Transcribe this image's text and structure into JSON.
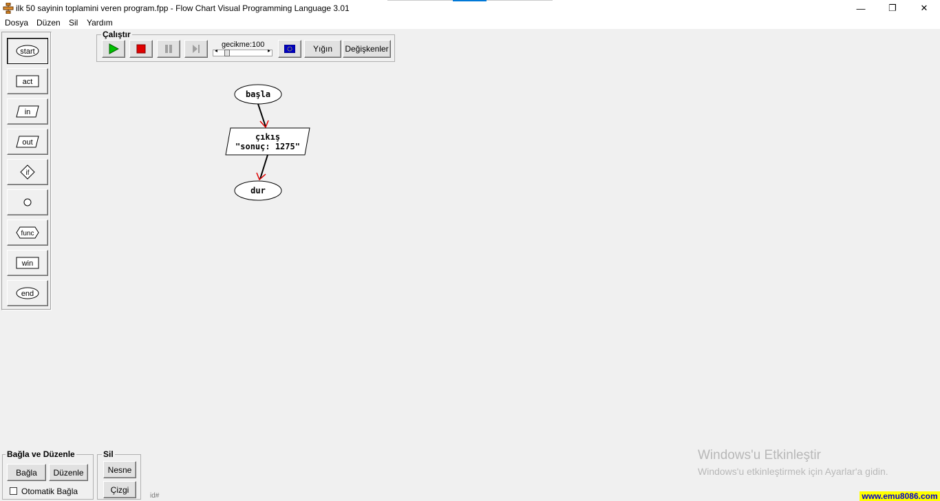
{
  "window": {
    "title": "ilk 50 sayinin toplamini veren program.fpp - Flow Chart Visual Programming Language 3.01",
    "minimize_glyph": "—",
    "restore_glyph": "❐",
    "close_glyph": "✕"
  },
  "menu": [
    "Dosya",
    "Düzen",
    "Sil",
    "Yardım"
  ],
  "palette": [
    {
      "label": "start",
      "shape": "ellipse"
    },
    {
      "label": "act",
      "shape": "rect"
    },
    {
      "label": "in",
      "shape": "parallelogram"
    },
    {
      "label": "out",
      "shape": "parallelogram"
    },
    {
      "label": "if",
      "shape": "diamond"
    },
    {
      "label": "",
      "shape": "circle"
    },
    {
      "label": "func",
      "shape": "hexagon"
    },
    {
      "label": "win",
      "shape": "rect"
    },
    {
      "label": "end",
      "shape": "ellipse"
    }
  ],
  "run_group": {
    "title": "Çalıştır",
    "delay_label": "gecikme:100",
    "stack_button": "Yığın",
    "variables_button": "Değişkenler"
  },
  "flowchart": {
    "start_node": "başla",
    "output_node_line1": "çıkış",
    "output_node_line2": "\"sonuç: 1275\"",
    "end_node": "dur"
  },
  "connect_group": {
    "title": "Bağla ve Düzenle",
    "connect_button": "Bağla",
    "arrange_button": "Düzenle",
    "auto_connect_label": "Otomatik Bağla",
    "auto_connect_checked": false
  },
  "delete_group": {
    "title": "Sil",
    "object_button": "Nesne",
    "line_button": "Çizgi"
  },
  "status": {
    "id_label": "id#"
  },
  "watermark": {
    "line1": "Windows'u Etkinleştir",
    "line2": "Windows'u etkinleştirmek için Ayarlar'a gidin."
  },
  "badge": "www.emu8086.com"
}
